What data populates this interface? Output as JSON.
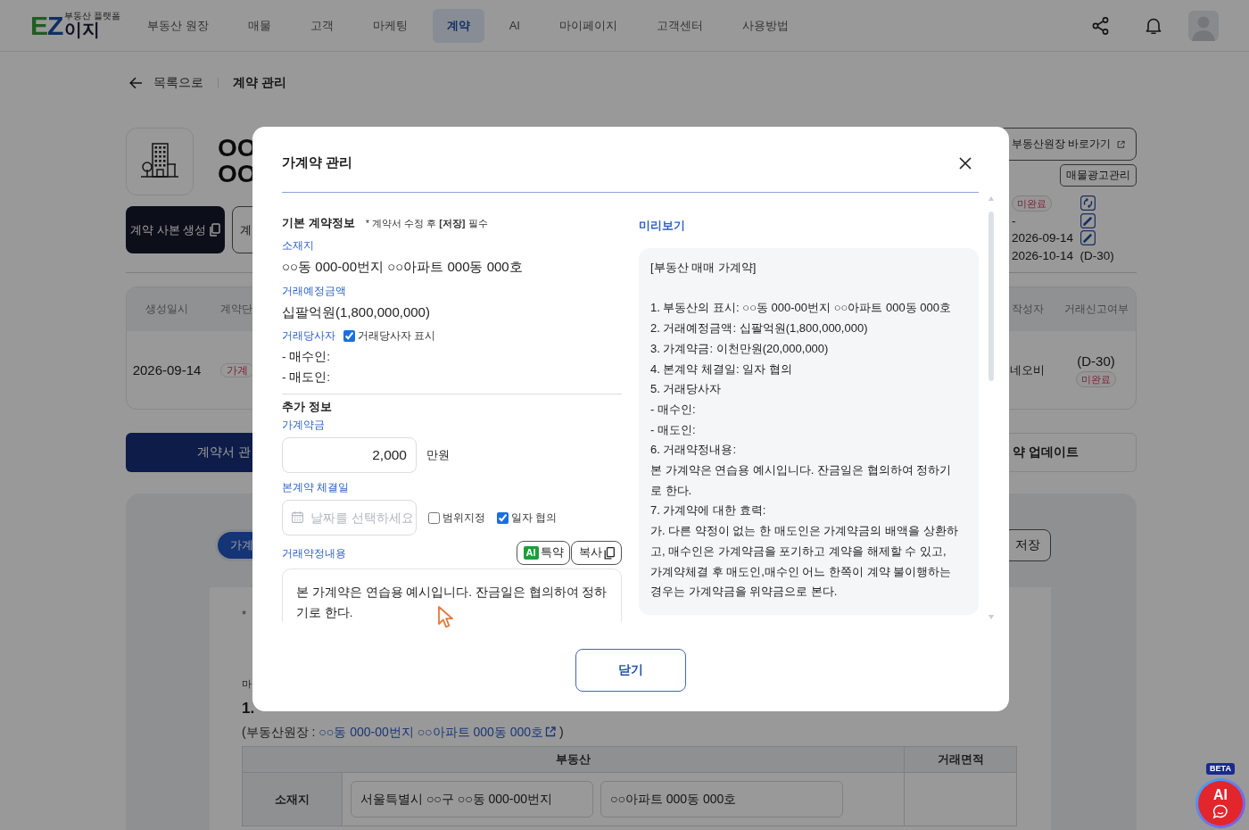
{
  "header": {
    "logo": {
      "mark": "EZ",
      "tagline": "부동산 플랫폼",
      "name": "이지"
    },
    "nav": [
      {
        "label": "부동산 원장",
        "selected": false
      },
      {
        "label": "매물",
        "selected": false
      },
      {
        "label": "고객",
        "selected": false
      },
      {
        "label": "마케팅",
        "selected": false
      },
      {
        "label": "계약",
        "selected": true
      },
      {
        "label": "AI",
        "selected": false
      },
      {
        "label": "마이페이지",
        "selected": false
      },
      {
        "label": "고객센터",
        "selected": false
      },
      {
        "label": "사용방법",
        "selected": false
      }
    ]
  },
  "breadcrumb": {
    "back": "목록으로",
    "current": "계약 관리"
  },
  "property": {
    "title_lines": [
      "OO",
      "OO"
    ],
    "actions": [
      {
        "label": "계약 사본 생성",
        "kind": "primary"
      },
      {
        "label": "계",
        "kind": "outline"
      }
    ],
    "ledger_button": "부동산원장 바로가기",
    "ad_button": "매물광고관리",
    "status_rows": [
      {
        "kind": "badge",
        "text": "미완료",
        "button": {
          "kind": "sync"
        }
      },
      {
        "kind": "text",
        "text": "-",
        "button": {
          "kind": "edit"
        }
      },
      {
        "kind": "text",
        "text": "2026-09-14",
        "button": {
          "kind": "edit"
        }
      },
      {
        "kind": "text",
        "text": "2026-10-14  (D-30)"
      }
    ]
  },
  "history_table": {
    "columns": [
      "생성일시",
      "계약단",
      "작성자",
      "거래신고여부"
    ],
    "rows": [
      {
        "created": "2026-09-14",
        "stage": "가계",
        "author": "네오비",
        "report_due": "(D-30)",
        "report_status": "미완료"
      }
    ]
  },
  "section_tabs": [
    {
      "label": "계약서 관",
      "selected": true
    },
    {
      "label": "약 업데이트",
      "selected": false
    }
  ],
  "document_panel": {
    "tabs": [
      {
        "label": "가계",
        "selected": true
      }
    ],
    "save_button": "저장",
    "note": "*",
    "line": "마",
    "heading": "1.",
    "ledger_ref": {
      "prefix": "(부동산원장 :",
      "link": "○○동 000-00번지 ○○아파트 000동 000호",
      "suffix": ")"
    },
    "table": {
      "columns": [
        "부동산",
        "거래면적"
      ],
      "rows": [
        {
          "label": "소재지",
          "values": [
            "서울특별시 ○○구 ○○동 000-00번지",
            "○○아파트 000동 000호"
          ]
        }
      ]
    }
  },
  "modal": {
    "title": "가계약 관리",
    "basic": {
      "heading": "기본 계약정보",
      "note": "* 계약서 수정 후 **[저장]** 필수",
      "fields": [
        {
          "label": "소재지",
          "value": "○○동 000-00번지 ○○아파트 000동 000호"
        },
        {
          "label": "거래예정금액",
          "value": "십팔억원(1,800,000,000)"
        }
      ],
      "parties": {
        "label": "거래당사자",
        "toggle": {
          "label": "거래당사자 표시",
          "checked": true
        },
        "lines": [
          "- 매수인:",
          "- 매도인:"
        ]
      }
    },
    "extra": {
      "heading": "추가 정보",
      "deposit": {
        "label": "가계약금",
        "value": "2,000",
        "unit": "만원"
      },
      "main_date": {
        "label": "본계약 체결일",
        "placeholder": "날짜를 선택하세요",
        "options": [
          {
            "label": "범위지정",
            "checked": false
          },
          {
            "label": "일자 협의",
            "checked": true
          }
        ]
      },
      "terms": {
        "label": "거래약정내용",
        "ai_button": {
          "tag": "AI",
          "label": "특약"
        },
        "copy_button": "복사",
        "value": "본 가계약은 연습용 예시입니다. 잔금일은 협의하여 정하기로 한다."
      }
    },
    "preview": {
      "label": "미리보기",
      "title": "[부동산 매매 가계약]",
      "lines": [
        "1. 부동산의 표시: ○○동 000-00번지 ○○아파트 000동 000호",
        "2. 거래예정금액: 십팔억원(1,800,000,000)",
        "3. 가계약금: 이천만원(20,000,000)",
        "4. 본계약 체결일: 일자 협의",
        "5. 거래당사자",
        "- 매수인:",
        "- 매도인:",
        "6. 거래약정내용:",
        "본 가계약은 연습용 예시입니다. 잔금일은 협의하여 정하기로 한다.",
        "7. 가계약에 대한 효력:",
        "가. 다른 약정이 없는 한 매도인은 가계약금의 배액을 상환하고, 매수인은 가계약금을 포기하고 계약을 해제할 수 있고, 가계약체결 후 매도인,매수인 어느 한쪽이 계약 불이행하는 경우는 가계약금을 위약금으로 본다."
      ]
    },
    "close_button": "닫기"
  },
  "ai_assistant": {
    "badge": "BETA",
    "label": "AI"
  }
}
